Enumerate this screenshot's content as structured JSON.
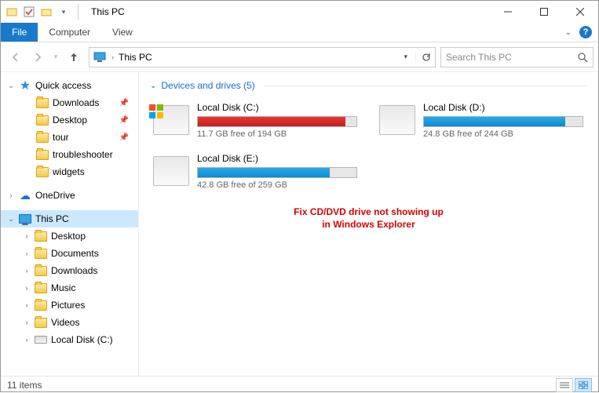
{
  "window": {
    "title": "This PC"
  },
  "ribbon": {
    "file": "File",
    "tabs": [
      "Computer",
      "View"
    ]
  },
  "address": {
    "crumb": "This PC",
    "search_placeholder": "Search This PC"
  },
  "sidebar": {
    "quick_access": "Quick access",
    "qa_items": [
      {
        "label": "Downloads",
        "pinned": true
      },
      {
        "label": "Desktop",
        "pinned": true
      },
      {
        "label": "tour",
        "pinned": true
      },
      {
        "label": "troubleshooter",
        "pinned": false
      },
      {
        "label": "widgets",
        "pinned": false
      }
    ],
    "onedrive": "OneDrive",
    "this_pc": "This PC",
    "pc_items": [
      {
        "label": "Desktop"
      },
      {
        "label": "Documents"
      },
      {
        "label": "Downloads"
      },
      {
        "label": "Music"
      },
      {
        "label": "Pictures"
      },
      {
        "label": "Videos"
      },
      {
        "label": "Local Disk (C:)"
      }
    ]
  },
  "content": {
    "group_title": "Devices and drives (5)",
    "drives": [
      {
        "name": "Local Disk (C:)",
        "free": "11.7 GB free of 194 GB",
        "fill_pct": 93,
        "color": "red",
        "windows": true
      },
      {
        "name": "Local Disk (D:)",
        "free": "24.8 GB free of 244 GB",
        "fill_pct": 89,
        "color": "blue",
        "windows": false
      },
      {
        "name": "Local Disk (E:)",
        "free": "42.8 GB free of 259 GB",
        "fill_pct": 83,
        "color": "blue",
        "windows": false
      }
    ],
    "overlay_line1": "Fix CD/DVD drive not showing up",
    "overlay_line2": "in Windows Explorer"
  },
  "status": {
    "text": "11 items"
  }
}
